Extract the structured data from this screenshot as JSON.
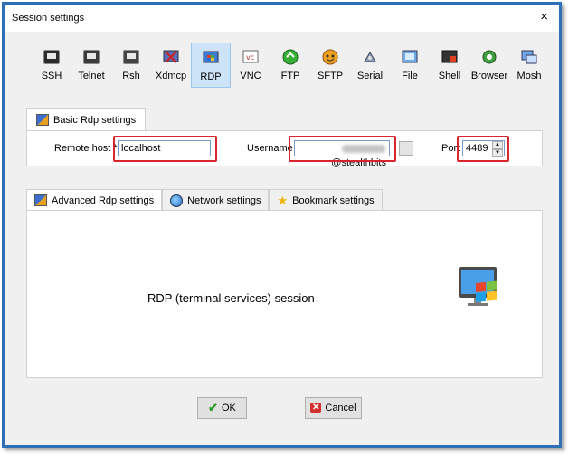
{
  "window": {
    "title": "Session settings",
    "close": "×"
  },
  "session_types": [
    {
      "label": "SSH",
      "icon": "ssh-terminal-icon"
    },
    {
      "label": "Telnet",
      "icon": "telnet-icon"
    },
    {
      "label": "Rsh",
      "icon": "rsh-icon"
    },
    {
      "label": "Xdmcp",
      "icon": "xdmcp-icon"
    },
    {
      "label": "RDP",
      "icon": "rdp-icon"
    },
    {
      "label": "VNC",
      "icon": "vnc-icon"
    },
    {
      "label": "FTP",
      "icon": "ftp-icon"
    },
    {
      "label": "SFTP",
      "icon": "sftp-icon"
    },
    {
      "label": "Serial",
      "icon": "serial-icon"
    },
    {
      "label": "File",
      "icon": "file-icon"
    },
    {
      "label": "Shell",
      "icon": "shell-icon"
    },
    {
      "label": "Browser",
      "icon": "browser-icon"
    },
    {
      "label": "Mosh",
      "icon": "mosh-icon"
    }
  ],
  "selected_type": "RDP",
  "basic": {
    "tab_label": "Basic Rdp settings",
    "remote_host_label": "Remote host *",
    "remote_host_value": "localhost",
    "username_label": "Username",
    "username_suffix": "@stealthbits",
    "port_label": "Port",
    "port_value": "4489"
  },
  "tabs": [
    {
      "label": "Advanced Rdp settings"
    },
    {
      "label": "Network settings"
    },
    {
      "label": "Bookmark settings"
    }
  ],
  "session_description": "RDP (terminal services) session",
  "buttons": {
    "ok": "OK",
    "cancel": "Cancel"
  },
  "colors": {
    "frame_border": "#2e6fb5",
    "highlight": "#d9262e",
    "selected_tab": "#cde3f7"
  }
}
